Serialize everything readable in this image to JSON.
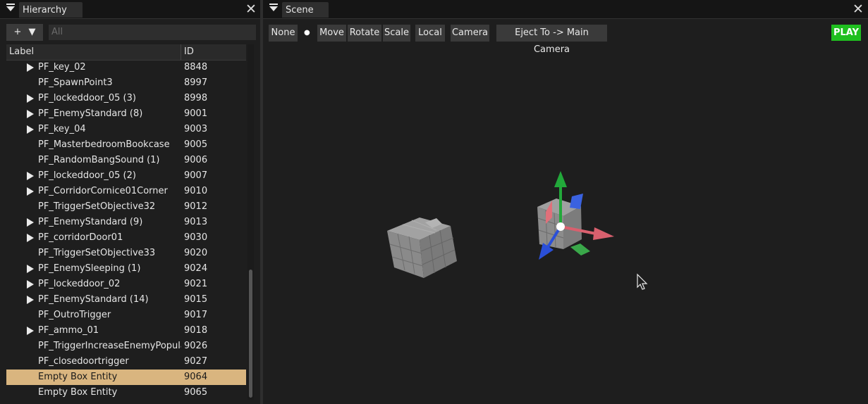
{
  "hierarchy": {
    "tab_title": "Hierarchy",
    "add_label": "+",
    "dropdown_glyph": "▼",
    "filter_placeholder": "All",
    "columns": {
      "label": "Label",
      "id": "ID"
    },
    "rows": [
      {
        "label": "PF_key_02",
        "id": "8848",
        "expandable": true
      },
      {
        "label": "PF_SpawnPoint3",
        "id": "8997",
        "expandable": false
      },
      {
        "label": "PF_lockeddoor_05 (3)",
        "id": "8998",
        "expandable": true
      },
      {
        "label": "PF_EnemyStandard (8)",
        "id": "9001",
        "expandable": true
      },
      {
        "label": "PF_key_04",
        "id": "9003",
        "expandable": true
      },
      {
        "label": "PF_MasterbedroomBookcase",
        "id": "9005",
        "expandable": false
      },
      {
        "label": "PF_RandomBangSound (1)",
        "id": "9006",
        "expandable": false
      },
      {
        "label": "PF_lockeddoor_05 (2)",
        "id": "9007",
        "expandable": true
      },
      {
        "label": "PF_CorridorCornice01Corner",
        "id": "9010",
        "expandable": true
      },
      {
        "label": "PF_TriggerSetObjective32",
        "id": "9012",
        "expandable": false
      },
      {
        "label": "PF_EnemyStandard (9)",
        "id": "9013",
        "expandable": true
      },
      {
        "label": "PF_corridorDoor01",
        "id": "9030",
        "expandable": true
      },
      {
        "label": "PF_TriggerSetObjective33",
        "id": "9020",
        "expandable": false
      },
      {
        "label": "PF_EnemySleeping (1)",
        "id": "9024",
        "expandable": true
      },
      {
        "label": "PF_lockeddoor_02",
        "id": "9021",
        "expandable": true
      },
      {
        "label": "PF_EnemyStandard (14)",
        "id": "9015",
        "expandable": true
      },
      {
        "label": "PF_OutroTrigger",
        "id": "9017",
        "expandable": false
      },
      {
        "label": "PF_ammo_01",
        "id": "9018",
        "expandable": true
      },
      {
        "label": "PF_TriggerIncreaseEnemyPopulation",
        "id": "9026",
        "expandable": false
      },
      {
        "label": "PF_closedoortrigger",
        "id": "9027",
        "expandable": false
      },
      {
        "label": "Empty Box Entity",
        "id": "9064",
        "expandable": false,
        "selected": true
      },
      {
        "label": "Empty Box Entity",
        "id": "9065",
        "expandable": false
      }
    ]
  },
  "scene": {
    "tab_title": "Scene",
    "toolbar": {
      "none": "None",
      "dot": "●",
      "move": "Move",
      "rotate": "Rotate",
      "scale": "Scale",
      "local": "Local",
      "camera": "Camera",
      "eject": "Eject To -> Main Camera"
    },
    "play_label": "PLAY"
  },
  "close_glyph": "✕",
  "colors": {
    "selection": "#d9b57f",
    "play": "#1fbf1f",
    "gizmo_x": "#d9606e",
    "gizmo_y": "#22a83a",
    "gizmo_z": "#2a4fd8",
    "plane_xz": "#3aa84a",
    "plane_yz": "#e0707a",
    "plane_xy": "#3a62e0"
  },
  "icons": [
    "tab-menu-icon",
    "close-icon",
    "expand-arrow-icon",
    "mouse-cursor-icon",
    "translate-gizmo-icon"
  ]
}
